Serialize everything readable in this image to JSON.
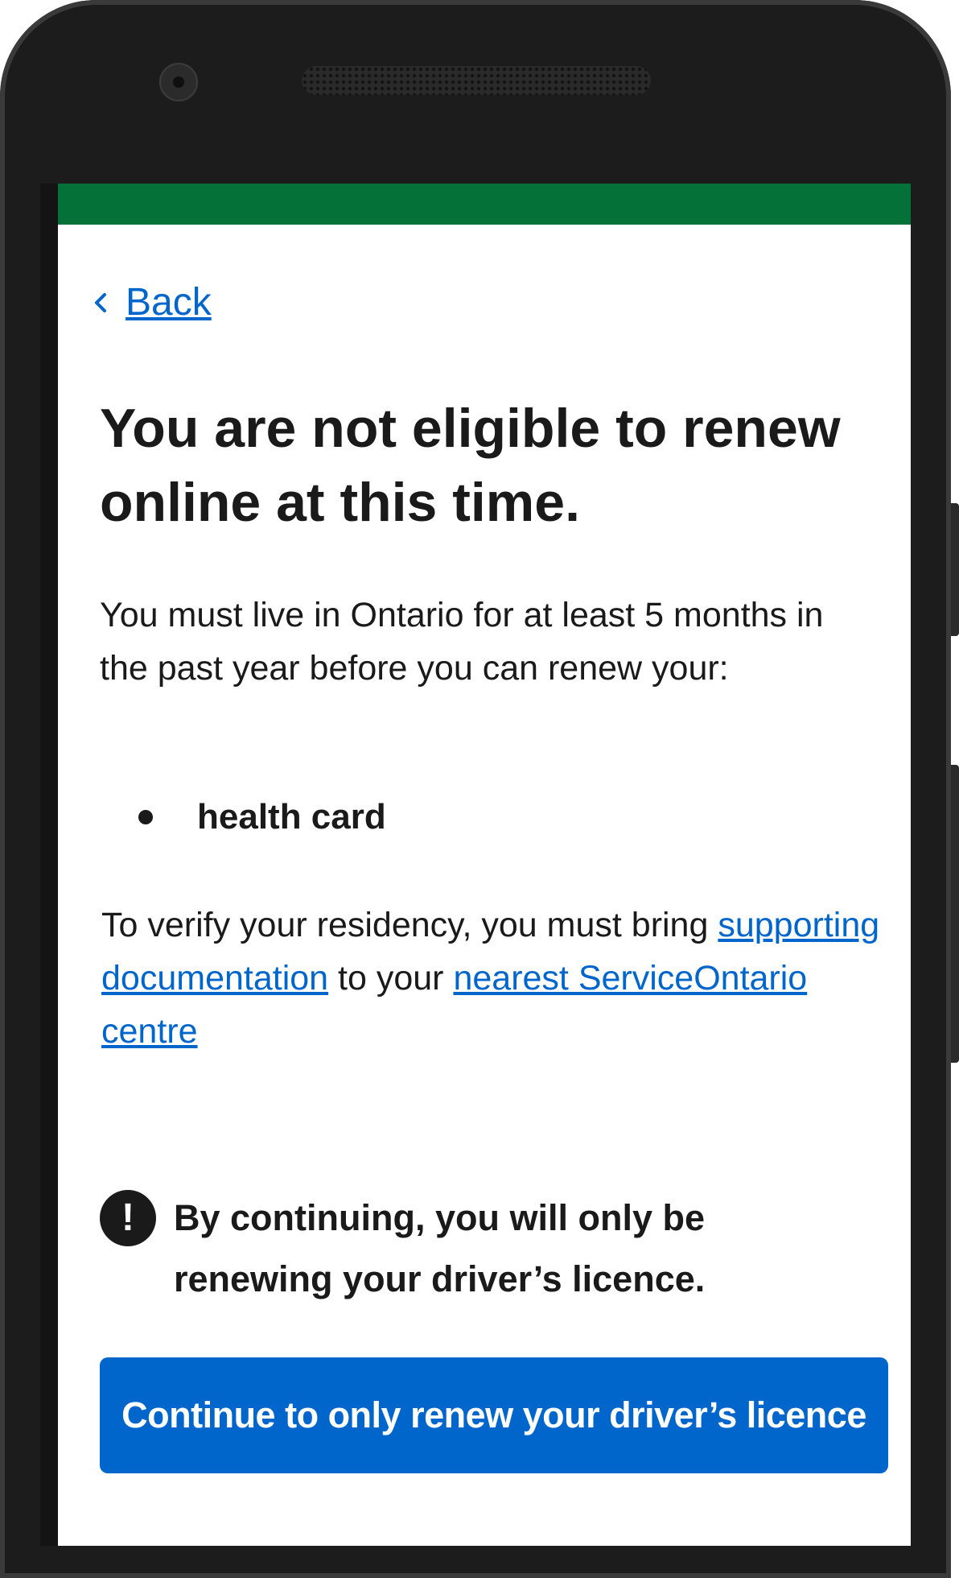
{
  "header": {
    "back_label": "Back"
  },
  "main": {
    "title_part1": "You are ",
    "title_emphasis": "not",
    "title_part2": " eligible to renew online at this time.",
    "intro": "You must live in Ontario for at least 5 months in the past year before you can renew your:",
    "items": [
      {
        "label": "health card"
      }
    ],
    "verify_text_1": "To verify your residency, you must bring ",
    "supporting_doc_link": "supporting documentation",
    "verify_text_2": " to your ",
    "nearest_centre_link": "nearest ServiceOntario centre",
    "warning_text": "By continuing, you will only be renewing your driver’s licence.",
    "warning_icon_glyph": "!",
    "continue_button": "Continue to only renew your driver’s licence"
  },
  "colors": {
    "brand_green": "#047238",
    "link_blue": "#0066cc",
    "button_blue": "#0066cc"
  },
  "icons": {
    "back": "chevron-left-icon",
    "warning": "exclamation-circle-icon"
  }
}
